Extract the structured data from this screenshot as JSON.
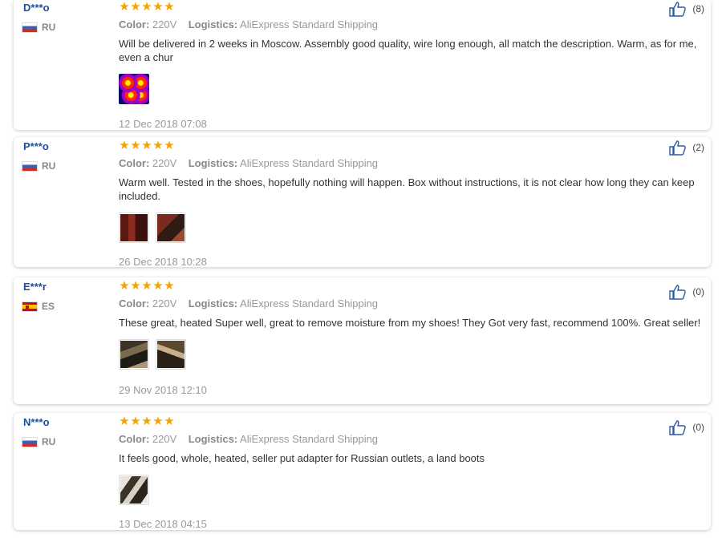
{
  "reviews": [
    {
      "user": "D***o",
      "country": "RU",
      "color_label": "Color:",
      "color_value": "220V",
      "logistics_label": "Logistics:",
      "logistics_value": "AliExpress Standard Shipping",
      "text": "Will be delivered in 2 weeks in Moscow. Assembly good quality, wire long enough, all match the description. Warm, as for me, even a chur",
      "date": "12 Dec 2018 07:08",
      "likes": "(8)",
      "rating": 5
    },
    {
      "user": "P***o",
      "country": "RU",
      "color_label": "Color:",
      "color_value": "220V",
      "logistics_label": "Logistics:",
      "logistics_value": "AliExpress Standard Shipping",
      "text": "Warm well. Tested in the shoes, hopefully nothing will happen. Box without instructions, it is not clear how long they can keep included.",
      "date": "26 Dec 2018 10:28",
      "likes": "(2)",
      "rating": 5
    },
    {
      "user": "E***r",
      "country": "ES",
      "color_label": "Color:",
      "color_value": "220V",
      "logistics_label": "Logistics:",
      "logistics_value": "AliExpress Standard Shipping",
      "text": "These great, heated Super well, great to remove moisture from my shoes! They Got very fast, recommend 100%. Great seller!",
      "date": "29 Nov 2018 12:10",
      "likes": "(0)",
      "rating": 5
    },
    {
      "user": "N***o",
      "country": "RU",
      "color_label": "Color:",
      "color_value": "220V",
      "logistics_label": "Logistics:",
      "logistics_value": "AliExpress Standard Shipping",
      "text": "It feels good, whole, heated, seller put adapter for Russian outlets, a land boots",
      "date": "13 Dec 2018 04:15",
      "likes": "(0)",
      "rating": 5
    }
  ],
  "colors": {
    "username": "#1f4f9c",
    "star": "#f5a300",
    "meta_text": "#999999"
  },
  "icons": {
    "like": "thumbs-up-icon",
    "star": "star-icon",
    "flag_ru": "russia-flag-icon",
    "flag_es": "spain-flag-icon"
  }
}
